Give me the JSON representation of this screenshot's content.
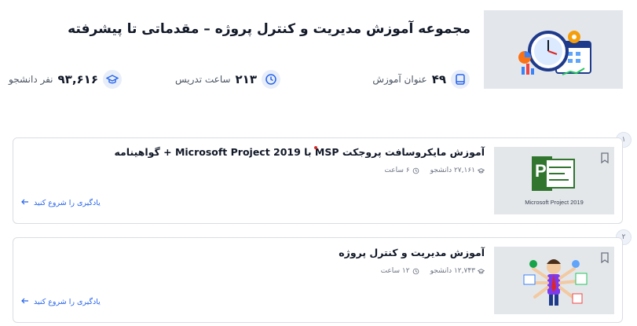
{
  "header": {
    "title": "مجموعه آموزش مدیریت و کنترل پروژه – مقدماتی تا پیشرفته",
    "stats": {
      "courses": {
        "value": "۴۹",
        "label": "عنوان آموزش",
        "icon": "book-icon"
      },
      "hours": {
        "value": "۲۱۳",
        "label": "ساعت تدریس",
        "icon": "clock-icon"
      },
      "students": {
        "value": "۹۳,۶۱۶",
        "label": "نفر دانشجو",
        "icon": "graduation-cap-icon"
      }
    }
  },
  "courses": [
    {
      "index": "۱",
      "title": "آموزش مایکروسافت پروجکت MSP با Microsoft Project 2019 + گواهینامه",
      "students": "۲۷,۱۶۱ دانشجو",
      "hours": "۶ ساعت",
      "cta": "یادگیری را شروع کنید",
      "thumb_caption": "Microsoft Project 2019",
      "thumb_logo": "P"
    },
    {
      "index": "۲",
      "title": "آموزش مدیریت و کنترل پروژه",
      "students": "۱۲,۷۴۳ دانشجو",
      "hours": "۱۲ ساعت",
      "cta": "یادگیری را شروع کنید"
    }
  ],
  "colors": {
    "accent": "#2563eb",
    "msp_green": "#31752f",
    "icon_bg": "#e8eef9"
  }
}
